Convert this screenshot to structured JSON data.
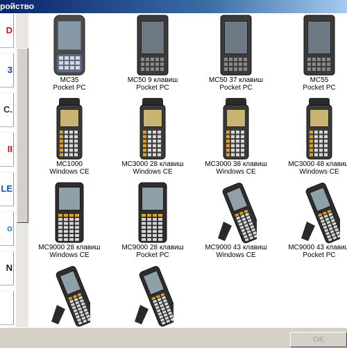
{
  "window": {
    "title": "ройство"
  },
  "vendors": [
    {
      "label": "D",
      "color": "#d01010"
    },
    {
      "label": "3",
      "color": "#1a3aa0"
    },
    {
      "label": "C.",
      "color": "#2a2a5a"
    },
    {
      "label": "II",
      "color": "#cc1010"
    },
    {
      "label": "LE",
      "color": "#1e4fa8"
    },
    {
      "label": "o",
      "color": "#1a8ad0"
    },
    {
      "label": "N",
      "color": "#222222"
    },
    {
      "label": "",
      "color": "#1a3aa0"
    }
  ],
  "devices": [
    {
      "name": "MC35",
      "os": "Pocket PC",
      "icon": "pda-keyboard-icon"
    },
    {
      "name": "MC50 9 клавиш",
      "os": "Pocket PC",
      "icon": "pda-icon"
    },
    {
      "name": "MC50 37 клавиш",
      "os": "Pocket PC",
      "icon": "pda-icon"
    },
    {
      "name": "MC55",
      "os": "Pocket PC",
      "icon": "pda-icon"
    },
    {
      "name": "MC1000",
      "os": "Windows CE",
      "icon": "handheld-scanner-icon"
    },
    {
      "name": "MC3000 28 клавиш",
      "os": "Windows CE",
      "icon": "handheld-scanner-icon"
    },
    {
      "name": "MC3000 38 клавиш",
      "os": "Windows CE",
      "icon": "handheld-scanner-icon"
    },
    {
      "name": "MC3000 48 клавиш",
      "os": "Windows CE",
      "icon": "handheld-scanner-icon"
    },
    {
      "name": "MC9000 28 клавиш",
      "os": "Windows CE",
      "icon": "rugged-terminal-icon"
    },
    {
      "name": "MC9000 28 клавиш",
      "os": "Pocket PC",
      "icon": "rugged-terminal-icon"
    },
    {
      "name": "MC9000 43 клавиш",
      "os": "Windows CE",
      "icon": "gun-terminal-icon"
    },
    {
      "name": "MC9000 43 клавиш",
      "os": "Pocket PC",
      "icon": "gun-terminal-icon"
    },
    {
      "name": "",
      "os": "",
      "icon": "gun-terminal-icon"
    },
    {
      "name": "",
      "os": "",
      "icon": "gun-terminal-icon"
    }
  ],
  "buttons": {
    "ok": "OK"
  }
}
